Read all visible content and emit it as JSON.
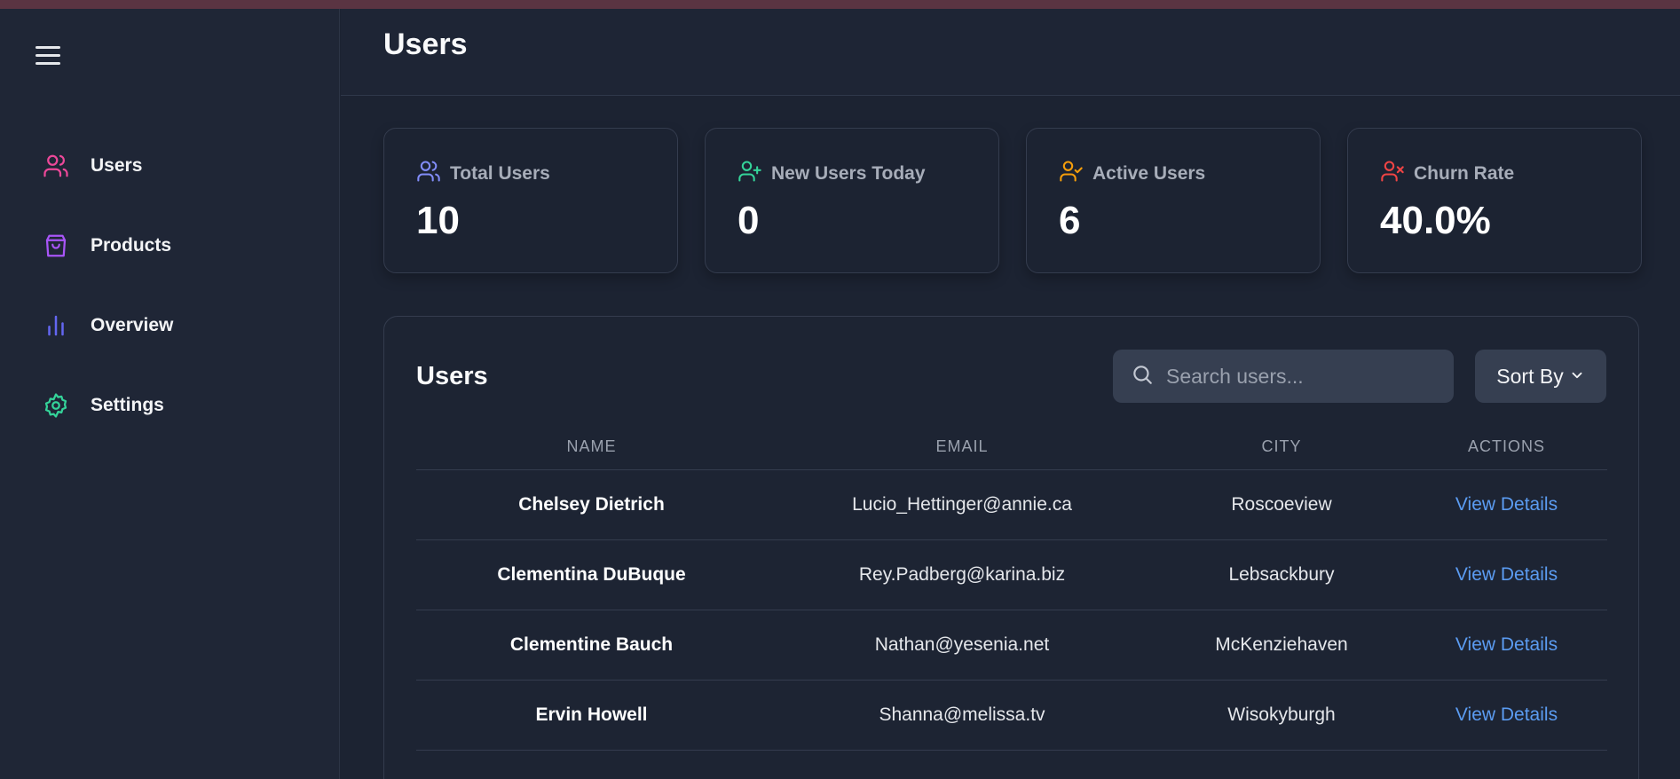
{
  "sidebar": {
    "menu_icon": "hamburger-icon",
    "items": [
      {
        "label": "Users",
        "icon": "users-icon",
        "color": "#ec4899"
      },
      {
        "label": "Products",
        "icon": "shopping-bag-icon",
        "color": "#a855f7"
      },
      {
        "label": "Overview",
        "icon": "bar-chart-icon",
        "color": "#6366f1"
      },
      {
        "label": "Settings",
        "icon": "gear-icon",
        "color": "#34d399"
      }
    ]
  },
  "header": {
    "title": "Users"
  },
  "stats": [
    {
      "label": "Total Users",
      "value": "10",
      "icon": "users-icon",
      "color": "#818cf8"
    },
    {
      "label": "New Users Today",
      "value": "0",
      "icon": "user-plus-icon",
      "color": "#34d399"
    },
    {
      "label": "Active Users",
      "value": "6",
      "icon": "user-check-icon",
      "color": "#f59e0b"
    },
    {
      "label": "Churn Rate",
      "value": "40.0%",
      "icon": "user-x-icon",
      "color": "#ef4444"
    }
  ],
  "table": {
    "title": "Users",
    "search_placeholder": "Search users...",
    "sort_label": "Sort By",
    "columns": [
      "NAME",
      "EMAIL",
      "CITY",
      "ACTIONS"
    ],
    "rows": [
      {
        "name": "Chelsey Dietrich",
        "email": "Lucio_Hettinger@annie.ca",
        "city": "Roscoeview",
        "action": "View Details"
      },
      {
        "name": "Clementina DuBuque",
        "email": "Rey.Padberg@karina.biz",
        "city": "Lebsackbury",
        "action": "View Details"
      },
      {
        "name": "Clementine Bauch",
        "email": "Nathan@yesenia.net",
        "city": "McKenziehaven",
        "action": "View Details"
      },
      {
        "name": "Ervin Howell",
        "email": "Shanna@melissa.tv",
        "city": "Wisokyburgh",
        "action": "View Details"
      }
    ]
  }
}
